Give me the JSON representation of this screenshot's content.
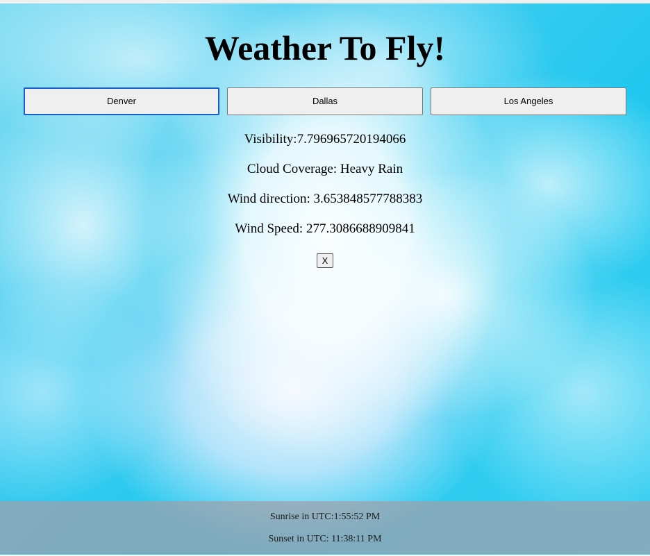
{
  "header": {
    "title": "Weather To Fly!"
  },
  "cities": [
    {
      "label": "Denver"
    },
    {
      "label": "Dallas"
    },
    {
      "label": "Los Angeles"
    }
  ],
  "weather": {
    "visibility_label": "Visibility:",
    "visibility_value": "7.796965720194066",
    "cloud_label": "Cloud Coverage: ",
    "cloud_value": "Heavy Rain",
    "wind_direction_label": "Wind direction: ",
    "wind_direction_value": "3.653848577788383",
    "wind_speed_label": "Wind Speed: ",
    "wind_speed_value": "277.3086688909841"
  },
  "close_button": {
    "label": "X"
  },
  "footer": {
    "sunrise_label": "Sunrise in UTC:",
    "sunrise_value": "1:55:52 PM",
    "sunset_label": "Sunset in UTC: ",
    "sunset_value": "11:38:11 PM"
  },
  "colors": {
    "sky": "#22c8ef",
    "footer_bg": "#a0a0aa",
    "focus_ring": "#1a5fc8"
  }
}
